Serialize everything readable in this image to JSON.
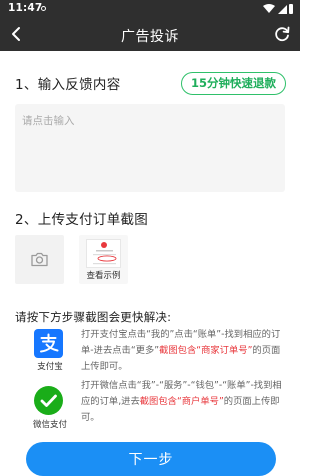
{
  "status_bar": {
    "time": "11:47"
  },
  "header": {
    "title": "广告投诉"
  },
  "feedback": {
    "section_title": "1、输入反馈内容",
    "refund_badge": "15分钟快速退款",
    "placeholder": "请点击输入",
    "value": ""
  },
  "upload": {
    "section_title": "2、上传支付订单截图",
    "example_label": "查看示例"
  },
  "help": {
    "title": "请按下方步骤截图会更快解决:",
    "methods": [
      {
        "name": "支付宝",
        "desc_1": "打开支付宝点击“我的”点击“账单”-找到相应的订单-进去点击“更多”",
        "desc_hl_1": "截图包含“商家订单号”",
        "desc_2": "的页面上传即可。"
      },
      {
        "name": "微信支付",
        "desc_1": "打开微信点击“我”-“服务”-“钱包”-“账单”-找到相应的订单,进去",
        "desc_hl_1": "截图包含“商户单号”",
        "desc_2": "的页面上传即可。"
      }
    ]
  },
  "footer": {
    "next_label": "下一步"
  },
  "colors": {
    "header_bg": "#2f2f2f",
    "badge_green": "#2fc06a",
    "highlight_red": "#e8383d",
    "primary_blue": "#1b8ff5",
    "alipay_blue": "#1677ff",
    "wechat_green": "#1aad19"
  }
}
